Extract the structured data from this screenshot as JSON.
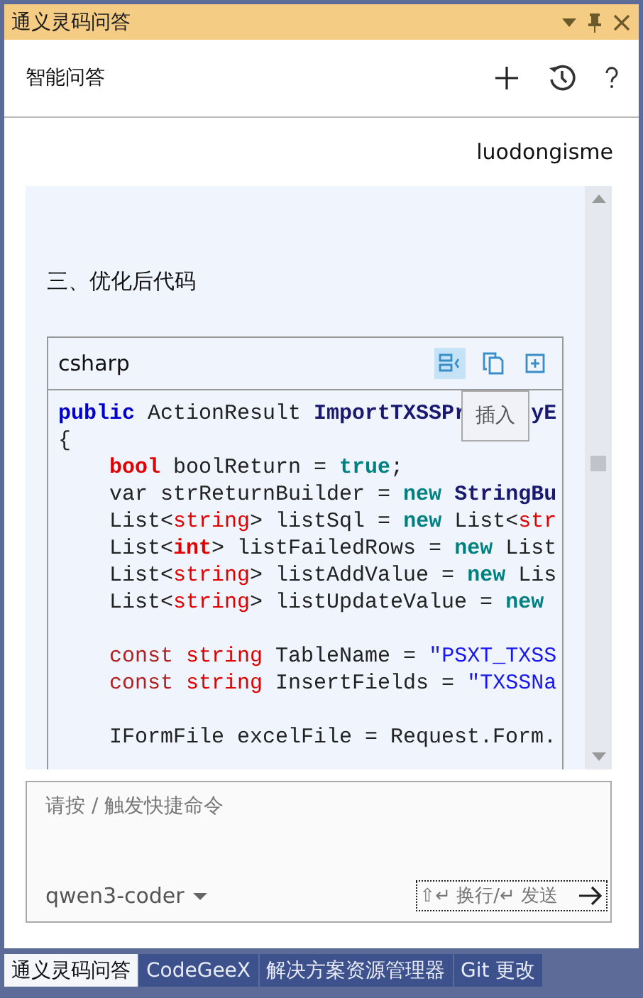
{
  "window": {
    "title": "通义灵码问答"
  },
  "header": {
    "title": "智能问答"
  },
  "user": "luodongisme",
  "message": {
    "heading": "三、优化后代码",
    "code_block": {
      "language": "csharp",
      "tooltip": "插入",
      "lines": [
        {
          "kind": "code",
          "indent": false,
          "tokens": [
            {
              "text": "public",
              "kind": "keyword"
            },
            {
              "text": " ActionResult ",
              "kind": "plain"
            },
            {
              "text": "ImportTXSSPr",
              "kind": "class"
            },
            {
              "kind": "covered"
            },
            {
              "text": "yE",
              "kind": "class"
            }
          ]
        },
        {
          "kind": "code",
          "indent": false,
          "tokens": [
            {
              "text": "{",
              "kind": "plain"
            }
          ]
        },
        {
          "kind": "code",
          "indent": true,
          "tokens": [
            {
              "text": "bool",
              "kind": "type"
            },
            {
              "text": " boolReturn = ",
              "kind": "plain"
            },
            {
              "text": "true",
              "kind": "literal"
            },
            {
              "text": ";",
              "kind": "plain"
            }
          ]
        },
        {
          "kind": "code",
          "indent": true,
          "tokens": [
            {
              "text": "var strReturnBuilder = ",
              "kind": "plain"
            },
            {
              "text": "new ",
              "kind": "literal"
            },
            {
              "text": "StringBu",
              "kind": "class"
            }
          ]
        },
        {
          "kind": "code",
          "indent": true,
          "tokens": [
            {
              "text": "List<",
              "kind": "plain"
            },
            {
              "text": "string",
              "kind": "generic"
            },
            {
              "text": "> listSql = ",
              "kind": "plain"
            },
            {
              "text": "new",
              "kind": "literal"
            },
            {
              "text": " List<",
              "kind": "plain"
            },
            {
              "text": "str",
              "kind": "generic"
            }
          ]
        },
        {
          "kind": "code",
          "indent": true,
          "tokens": [
            {
              "text": "List<",
              "kind": "plain"
            },
            {
              "text": "int",
              "kind": "type"
            },
            {
              "text": "> listFailedRows = ",
              "kind": "plain"
            },
            {
              "text": "new",
              "kind": "literal"
            },
            {
              "text": " List",
              "kind": "plain"
            }
          ]
        },
        {
          "kind": "code",
          "indent": true,
          "tokens": [
            {
              "text": "List<",
              "kind": "plain"
            },
            {
              "text": "string",
              "kind": "generic"
            },
            {
              "text": "> listAddValue = ",
              "kind": "plain"
            },
            {
              "text": "new",
              "kind": "literal"
            },
            {
              "text": " Lis",
              "kind": "plain"
            }
          ]
        },
        {
          "kind": "code",
          "indent": true,
          "tokens": [
            {
              "text": "List<",
              "kind": "plain"
            },
            {
              "text": "string",
              "kind": "generic"
            },
            {
              "text": "> listUpdateValue = ",
              "kind": "plain"
            },
            {
              "text": "new",
              "kind": "literal"
            }
          ]
        },
        {
          "kind": "blank"
        },
        {
          "kind": "code",
          "indent": true,
          "tokens": [
            {
              "text": "const ",
              "kind": "modifier"
            },
            {
              "text": "string",
              "kind": "generic"
            },
            {
              "text": " TableName = ",
              "kind": "plain"
            },
            {
              "text": "\"PSXT_TXSS",
              "kind": "string"
            }
          ]
        },
        {
          "kind": "code",
          "indent": true,
          "tokens": [
            {
              "text": "const ",
              "kind": "modifier"
            },
            {
              "text": "string",
              "kind": "generic"
            },
            {
              "text": " InsertFields = ",
              "kind": "plain"
            },
            {
              "text": "\"TXSSNa",
              "kind": "string"
            }
          ]
        },
        {
          "kind": "blank"
        },
        {
          "kind": "code",
          "indent": true,
          "tokens": [
            {
              "text": "IFormFile excelFile = Request.Form.",
              "kind": "plain"
            }
          ]
        }
      ]
    }
  },
  "input": {
    "placeholder": "请按 / 触发快捷命令",
    "model": "qwen3-coder",
    "hint": "⇧↵ 换行/↵ 发送"
  },
  "tool_tabs": [
    {
      "label": "通义灵码问答",
      "selected": true
    },
    {
      "label": "CodeGeeX",
      "selected": false
    },
    {
      "label": "解决方案资源管理器",
      "selected": false
    },
    {
      "label": "Git 更改",
      "selected": false
    }
  ]
}
